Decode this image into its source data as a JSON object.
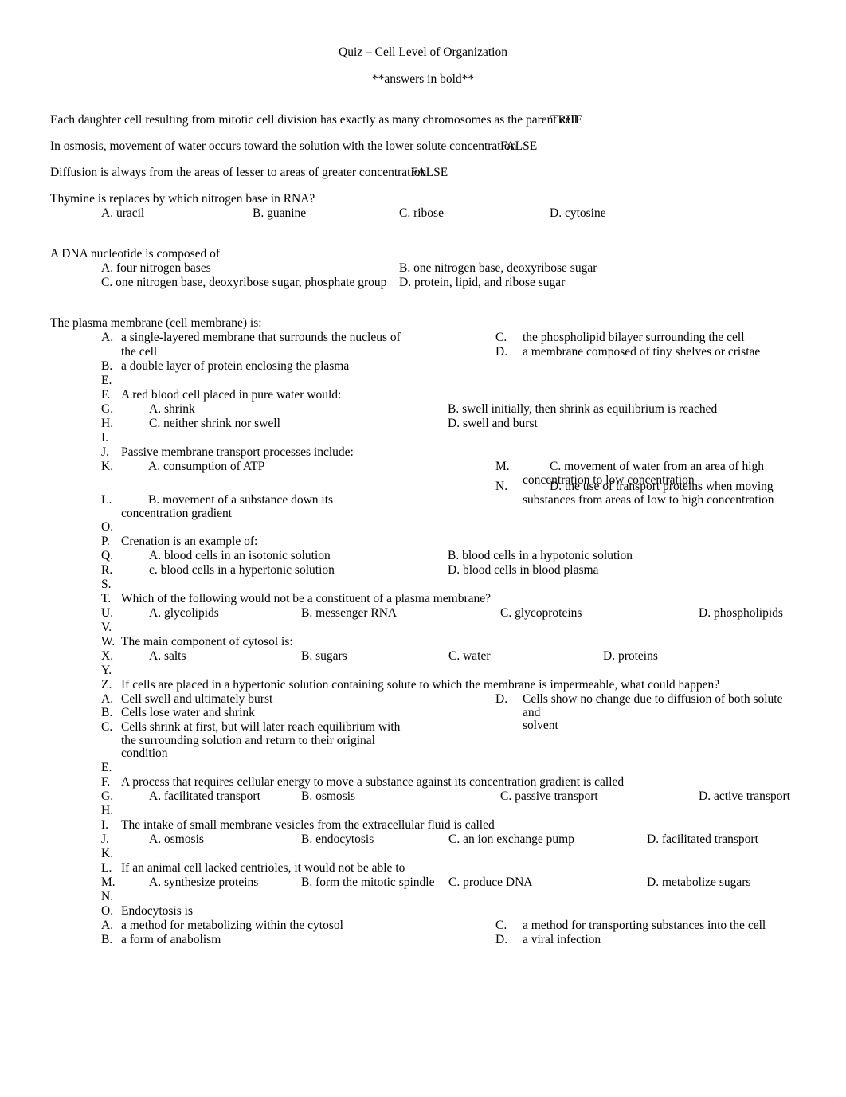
{
  "document": {
    "title": "Quiz – Cell Level of Organization",
    "subtitle": "**answers in bold**"
  },
  "true_false": [
    {
      "statement": "Each daughter cell resulting from mitotic cell division has exactly as many chromosomes as the parent cell",
      "answer": "TRUE"
    },
    {
      "statement": "In osmosis, movement of water occurs toward the solution with the lower solute concentration",
      "answer": "FALSE"
    },
    {
      "statement": "Diffusion is always from the areas of lesser to areas of greater concentration",
      "answer": "FALSE"
    }
  ],
  "q1": {
    "stem": "Thymine is replaces by which nitrogen base in RNA?",
    "a": "A. uracil",
    "b": "B. guanine",
    "c": "C. ribose",
    "d": "D. cytosine"
  },
  "q2": {
    "stem": "A DNA nucleotide is composed of",
    "a": "A. four nitrogen bases",
    "b": "B. one nitrogen base, deoxyribose sugar",
    "c": "C. one nitrogen base, deoxyribose sugar, phosphate group",
    "d": "D. protein, lipid, and ribose sugar"
  },
  "q3": {
    "stem": "The plasma membrane (cell membrane) is:",
    "items": [
      {
        "label": "A.",
        "text": "a single-layered membrane that surrounds the nucleus of"
      },
      {
        "label": "",
        "text": "the cell"
      },
      {
        "label": "B.",
        "text": "a double layer of protein enclosing the plasma"
      },
      {
        "label": "C.",
        "text": "the phospholipid bilayer surrounding the cell"
      },
      {
        "label": "D.",
        "text": "a membrane composed of tiny shelves or cristae"
      }
    ]
  },
  "list_items": {
    "e1": {
      "label": "E.",
      "text": ""
    },
    "f1": {
      "label": "F.",
      "text": "A red blood cell placed in pure water would:"
    },
    "g1": {
      "label": "G.",
      "opt_a": "A. shrink",
      "opt_b": "B. swell initially, then shrink as equilibrium is reached"
    },
    "h1": {
      "label": "H.",
      "opt_c": "C. neither shrink nor swell",
      "opt_d": "D. swell and burst"
    },
    "i1": {
      "label": "I.",
      "text": ""
    },
    "j1": {
      "label": "J.",
      "text": "Passive membrane transport processes include:"
    },
    "k1": {
      "label": "K.",
      "text": "A. consumption of ATP"
    },
    "m1": {
      "label": "M.",
      "line1": "C. movement of water from an area of high",
      "line2": "concentration to low concentration"
    },
    "l1": {
      "label": "L.",
      "line1": "B. movement of a substance down its",
      "line2": "concentration gradient"
    },
    "n1": {
      "label": "N.",
      "line1": "D. the use of transport proteins when moving",
      "line2": "substances from areas of low to high concentration"
    },
    "o1": {
      "label": "O.",
      "text": ""
    },
    "p1": {
      "label": "P.",
      "text": "Crenation is an example of:"
    },
    "q1": {
      "label": "Q.",
      "opt_a": "A. blood cells in an isotonic solution",
      "opt_b": "B. blood cells in a hypotonic solution"
    },
    "r1": {
      "label": "R.",
      "opt_c": "c. blood cells in a hypertonic solution",
      "opt_d": "D. blood cells in blood plasma"
    },
    "s1": {
      "label": "S.",
      "text": ""
    },
    "t1": {
      "label": "T.",
      "text": "Which of the following would not be a constituent of a plasma membrane?"
    },
    "u1": {
      "label": "U.",
      "a": "A. glycolipids",
      "b": "B. messenger RNA",
      "c": "C. glycoproteins",
      "d": "D. phospholipids"
    },
    "v1": {
      "label": "V.",
      "text": ""
    },
    "w1": {
      "label": "W.",
      "text": "The main component of cytosol is:"
    },
    "x1": {
      "label": "X.",
      "a": "A. salts",
      "b": "B. sugars",
      "c": "C. water",
      "d": "D. proteins"
    },
    "y1": {
      "label": "Y.",
      "text": ""
    },
    "z1": {
      "label": "Z.",
      "text": "If cells are placed in a hypertonic solution containing solute to which the membrane is impermeable, what could happen?"
    },
    "a2": {
      "label": "A.",
      "text": "Cell swell and ultimately burst"
    },
    "d2": {
      "label": "D.",
      "line1": "Cells show no change due to diffusion of both solute and",
      "line2": "solvent"
    },
    "b2": {
      "label": "B.",
      "text": "Cells lose water and shrink"
    },
    "c2": {
      "label": "C.",
      "line1": "Cells shrink at first, but will later reach equilibrium with",
      "line2": "the surrounding solution and return to their original",
      "line3": "condition"
    },
    "e2": {
      "label": "E.",
      "text": ""
    },
    "f2": {
      "label": "F.",
      "text": "A process that requires cellular energy to move a substance against its concentration gradient is called"
    },
    "g2": {
      "label": "G.",
      "a": "A. facilitated transport",
      "b": "B. osmosis",
      "c": "C. passive transport",
      "d": "D. active transport"
    },
    "h2": {
      "label": "H.",
      "text": ""
    },
    "i2": {
      "label": "I.",
      "text": "The intake of small membrane vesicles from the extracellular fluid is called"
    },
    "j2": {
      "label": "J.",
      "a": "A. osmosis",
      "b": "B. endocytosis",
      "c": "C. an ion exchange pump",
      "d": "D. facilitated transport"
    },
    "k2": {
      "label": "K.",
      "text": ""
    },
    "l2": {
      "label": "L.",
      "text": "If an animal cell lacked centrioles, it would not be able to"
    },
    "m2": {
      "label": "M.",
      "a": "A. synthesize proteins",
      "b": "B. form the mitotic spindle",
      "c": "C. produce DNA",
      "d": "D. metabolize sugars"
    },
    "n2": {
      "label": "N.",
      "text": ""
    },
    "o2": {
      "label": "O.",
      "text": "Endocytosis is"
    },
    "a3": {
      "label": "A.",
      "text": "a method for metabolizing within the cytosol"
    },
    "c3": {
      "label": "C.",
      "text": "a method for transporting substances into the cell"
    },
    "b3": {
      "label": "B.",
      "text": "a form of anabolism"
    },
    "d3": {
      "label": "D.",
      "text": "a viral infection"
    }
  }
}
